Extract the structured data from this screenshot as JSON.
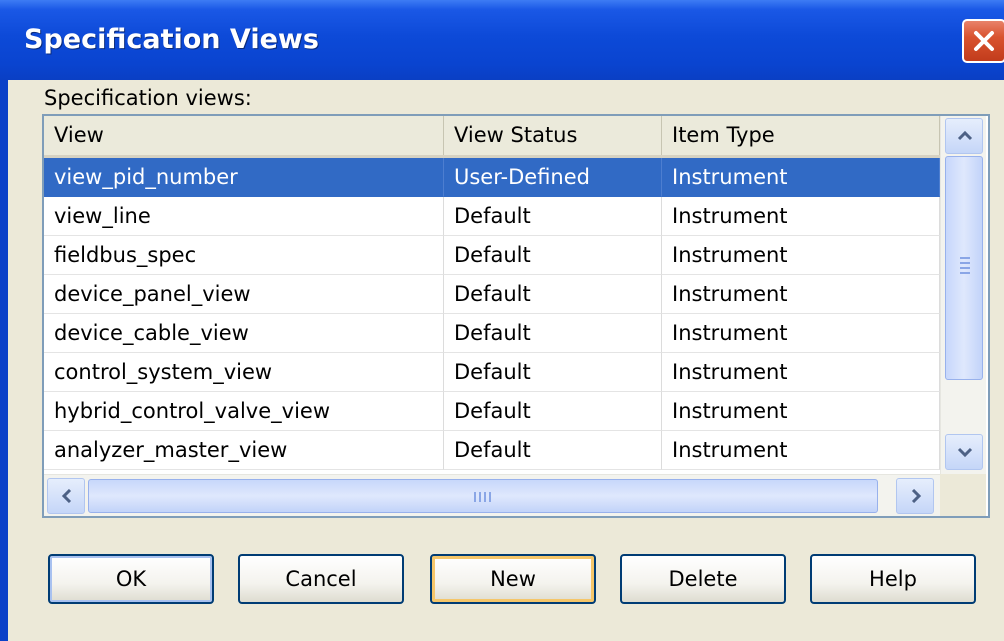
{
  "window": {
    "title": "Specification Views"
  },
  "list": {
    "caption": "Specification views:",
    "columns": [
      "View",
      "View Status",
      "Item Type"
    ],
    "rows": [
      [
        "view_pid_number",
        "User-Defined",
        "Instrument"
      ],
      [
        "view_line",
        "Default",
        "Instrument"
      ],
      [
        "fieldbus_spec",
        "Default",
        "Instrument"
      ],
      [
        "device_panel_view",
        "Default",
        "Instrument"
      ],
      [
        "device_cable_view",
        "Default",
        "Instrument"
      ],
      [
        "control_system_view",
        "Default",
        "Instrument"
      ],
      [
        "hybrid_control_valve_view",
        "Default",
        "Instrument"
      ],
      [
        "analyzer_master_view",
        "Default",
        "Instrument"
      ]
    ],
    "selected_row": "view_pid_number"
  },
  "buttons": {
    "ok": "OK",
    "cancel": "Cancel",
    "new": "New",
    "delete": "Delete",
    "help": "Help"
  },
  "icons": {
    "close": "close-icon",
    "scroll_up": "chevron-up-icon",
    "scroll_down": "chevron-down-icon",
    "scroll_left": "chevron-left-icon",
    "scroll_right": "chevron-right-icon"
  },
  "colors": {
    "titlebar": "#0a44d0",
    "selection": "#316ac5",
    "dialog_bg": "#ece9d8",
    "close_button": "#d9532f"
  }
}
